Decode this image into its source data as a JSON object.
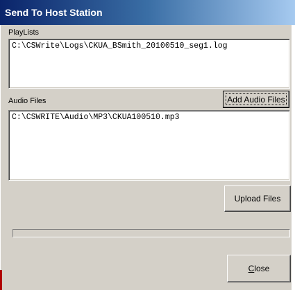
{
  "window": {
    "title": "Send To Host Station"
  },
  "playlists": {
    "label": "PlayLists",
    "items": [
      "C:\\CSWrite\\Logs\\CKUA_BSmith_20100510_seg1.log"
    ]
  },
  "audio_files": {
    "label": "Audio Files",
    "items": [
      "C:\\CSWRITE\\Audio\\MP3\\CKUA100510.mp3"
    ],
    "add_button_label": "Add Audio Files"
  },
  "upload": {
    "button_label": "Upload Files",
    "progress": 0
  },
  "close": {
    "label_accel": "C",
    "label_rest": "lose"
  }
}
